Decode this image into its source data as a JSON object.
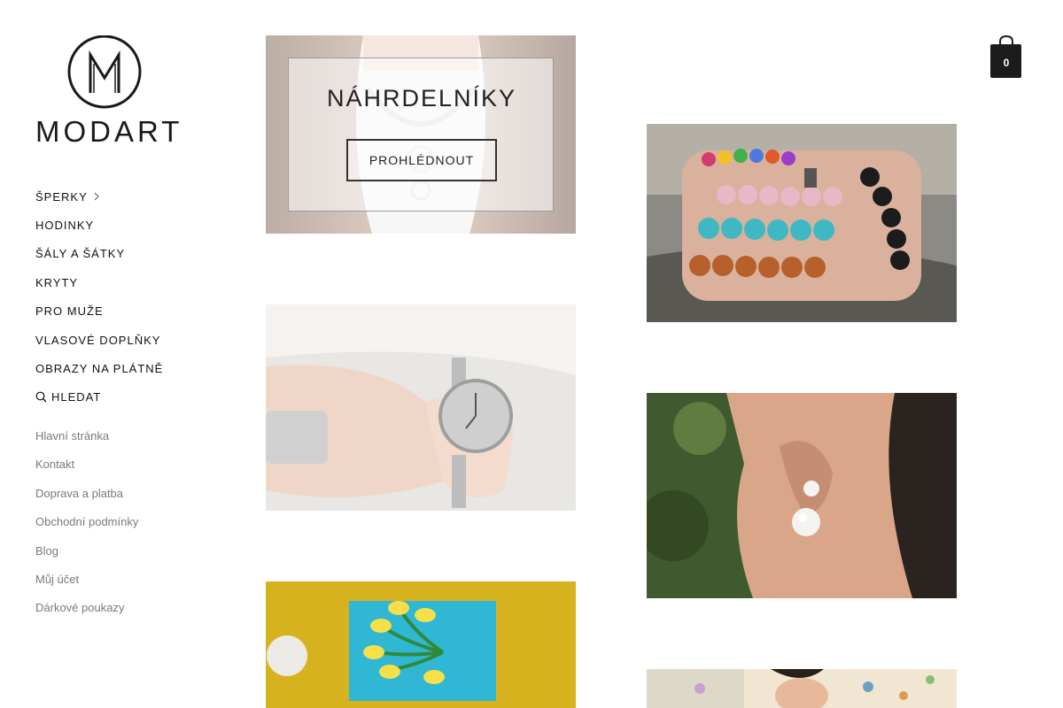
{
  "brand": {
    "name": "MODART"
  },
  "cart": {
    "count": "0",
    "icon": "shopping-bag-icon"
  },
  "main_nav": [
    {
      "label": "ŠPERKY",
      "icon": "chevron-right-icon"
    },
    {
      "label": "HODINKY"
    },
    {
      "label": "ŠÁLY A ŠÁTKY"
    },
    {
      "label": "KRYTY"
    },
    {
      "label": "PRO MUŽE"
    },
    {
      "label": "VLASOVÉ DOPLŇKY"
    },
    {
      "label": "OBRAZY NA PLÁTNĚ"
    },
    {
      "label": "HLEDAT",
      "icon": "search-icon"
    }
  ],
  "secondary_nav": [
    {
      "label": "Hlavní stránka"
    },
    {
      "label": "Kontakt"
    },
    {
      "label": "Doprava a platba"
    },
    {
      "label": "Obchodní podmínky"
    },
    {
      "label": "Blog"
    },
    {
      "label": "Můj účet"
    },
    {
      "label": "Dárkové poukazy"
    }
  ],
  "featured": {
    "title": "NÁHRDELNÍKY",
    "button_label": "PROHLÉDNOUT"
  },
  "colors": {
    "text": "#1a1a1a",
    "muted_link": "#7a7a7a",
    "cart_bg": "#1c1c1c",
    "canvas_yellow": "#d6b21f",
    "canvas_turquoise": "#2fb7d3"
  }
}
